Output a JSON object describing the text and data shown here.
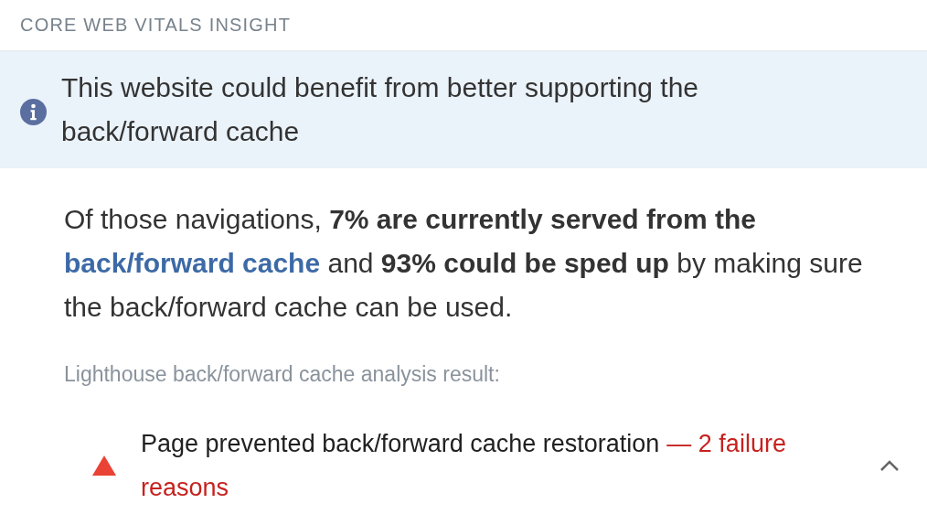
{
  "section_title": "CORE WEB VITALS INSIGHT",
  "insight": {
    "message": "This website could benefit from better supporting the back/forward cache"
  },
  "summary": [
    {
      "kind": "text",
      "text": "Of those navigations, **7% are currently served from the** "
    },
    {
      "kind": "link",
      "text": "back/forward cache"
    },
    {
      "kind": "text",
      "text": " and **93% could be sped up** by making sure the back/forward cache can be used."
    }
  ],
  "analysis_label": "Lighthouse back/forward cache analysis result:",
  "audit": {
    "kind": "fail",
    "title": "Page prevented back/forward cache restoration",
    "display_value": "— 2 failure reasons",
    "expanded": true
  }
}
